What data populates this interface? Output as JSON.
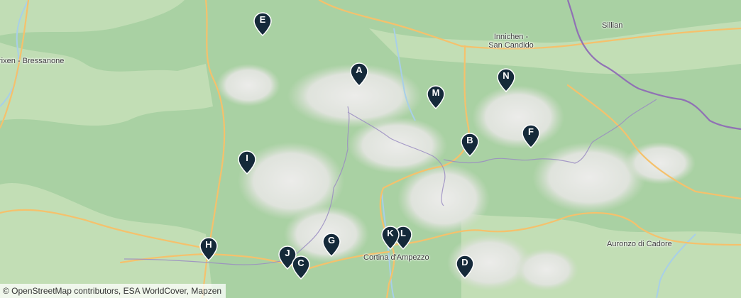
{
  "map": {
    "style": "terrain",
    "colors": {
      "forest": "#a9d1a3",
      "valley": "#c4dfb7",
      "rock": "#e8e8e6",
      "river": "#a8cfe8",
      "road": "#f5c16c",
      "border": "#8e6bb5",
      "marker": "#152a3a"
    },
    "places": [
      {
        "id": "brixen",
        "label": "rixen - Bressanone"
      },
      {
        "id": "innichen",
        "label": "Innichen -\nSan Candido"
      },
      {
        "id": "sillian",
        "label": "Sillian"
      },
      {
        "id": "cortina",
        "label": "Cortina d'Ampezzo"
      },
      {
        "id": "auronzo",
        "label": "Auronzo di Cadore"
      }
    ],
    "markers": [
      {
        "letter": "E",
        "icon": "map-pin-icon"
      },
      {
        "letter": "A",
        "icon": "map-pin-icon"
      },
      {
        "letter": "M",
        "icon": "map-pin-icon"
      },
      {
        "letter": "N",
        "icon": "map-pin-icon"
      },
      {
        "letter": "B",
        "icon": "map-pin-icon"
      },
      {
        "letter": "F",
        "icon": "map-pin-icon"
      },
      {
        "letter": "I",
        "icon": "map-pin-icon"
      },
      {
        "letter": "K",
        "icon": "map-pin-icon"
      },
      {
        "letter": "L",
        "icon": "map-pin-icon"
      },
      {
        "letter": "G",
        "icon": "map-pin-icon"
      },
      {
        "letter": "H",
        "icon": "map-pin-icon"
      },
      {
        "letter": "J",
        "icon": "map-pin-icon"
      },
      {
        "letter": "C",
        "icon": "map-pin-icon"
      },
      {
        "letter": "D",
        "icon": "map-pin-icon"
      }
    ],
    "attribution": "© OpenStreetMap contributors, ESA WorldCover, Mapzen"
  }
}
